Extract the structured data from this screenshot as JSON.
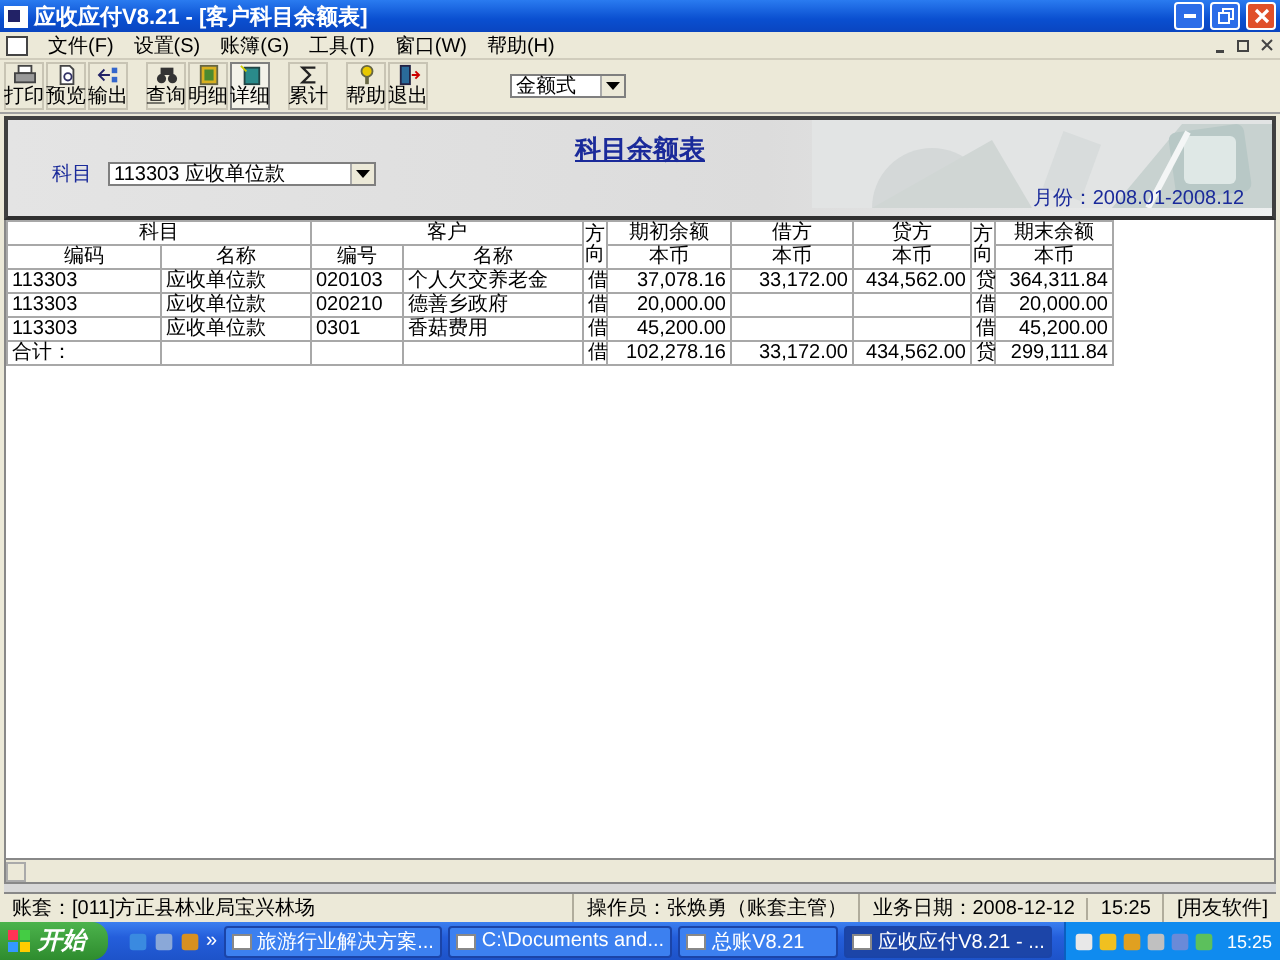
{
  "window": {
    "title": "应收应付V8.21 - [客户科目余额表]"
  },
  "menu": [
    "文件(F)",
    "设置(S)",
    "账簿(G)",
    "工具(T)",
    "窗口(W)",
    "帮助(H)"
  ],
  "toolbar": [
    {
      "label": "打印",
      "pressed": false
    },
    {
      "label": "预览",
      "pressed": false
    },
    {
      "label": "输出",
      "pressed": false
    },
    {
      "label": "查询",
      "pressed": false
    },
    {
      "label": "明细",
      "pressed": false
    },
    {
      "label": "详细",
      "pressed": true
    },
    {
      "label": "累计",
      "pressed": false
    },
    {
      "label": "帮助",
      "pressed": false
    },
    {
      "label": "退出",
      "pressed": false
    }
  ],
  "format_select": {
    "value": "金额式"
  },
  "report": {
    "title": "科目余额表",
    "account_label": "科目",
    "account_value": "113303 应收单位款",
    "period": "月份：2008.01-2008.12"
  },
  "table": {
    "group_headers": [
      "科目",
      "客户",
      "方向",
      "期初余额",
      "借方",
      "贷方",
      "方向",
      "期末余额"
    ],
    "sub_headers": [
      "编码",
      "名称",
      "编号",
      "名称",
      "本币",
      "本币",
      "本币",
      "本币"
    ],
    "rows": [
      {
        "code": "113303",
        "name": "应收单位款",
        "cust_code": "020103",
        "cust_name": "个人欠交养老金",
        "dir": "借",
        "opening": "37,078.16",
        "debit": "33,172.00",
        "credit": "434,562.00",
        "end_dir": "贷",
        "closing": "364,311.84"
      },
      {
        "code": "113303",
        "name": "应收单位款",
        "cust_code": "020210",
        "cust_name": "德善乡政府",
        "dir": "借",
        "opening": "20,000.00",
        "end_dir": "借",
        "closing": "20,000.00"
      },
      {
        "code": "113303",
        "name": "应收单位款",
        "cust_code": "0301",
        "cust_name": "香菇费用",
        "dir": "借",
        "opening": "45,200.00",
        "end_dir": "借",
        "closing": "45,200.00"
      },
      {
        "code": "合计：",
        "dir": "借",
        "opening": "102,278.16",
        "debit": "33,172.00",
        "credit": "434,562.00",
        "end_dir": "贷",
        "closing": "299,111.84"
      }
    ]
  },
  "status_bar": {
    "account": "账套：[011]方正县林业局宝兴林场",
    "operator": "操作员：张焕勇（账套主管）",
    "date": "业务日期：2008-12-12",
    "time": "15:25",
    "company": "[用友软件]"
  },
  "taskbar": {
    "start": "开始",
    "more": "»",
    "tasks": [
      {
        "label": "旅游行业解决方案...",
        "selected": false
      },
      {
        "label": "C:\\Documents and...",
        "selected": false
      },
      {
        "label": "总账V8.21",
        "selected": false
      },
      {
        "label": "应收应付V8.21 - ...",
        "selected": true
      }
    ],
    "clock": "15:25"
  }
}
